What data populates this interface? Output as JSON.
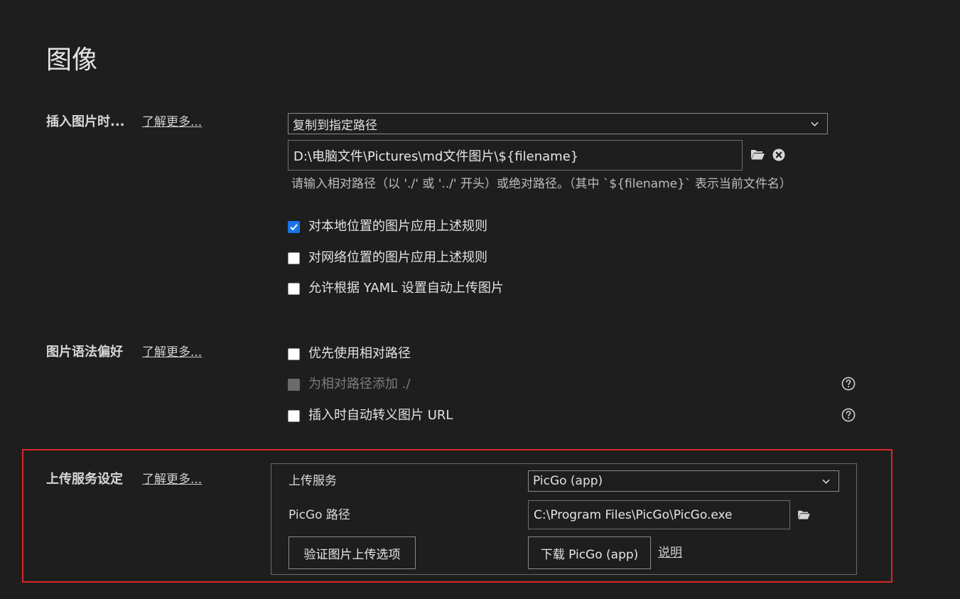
{
  "page": {
    "title": "图像"
  },
  "learn_more": "了解更多...",
  "insert": {
    "label": "插入图片时...",
    "action_select": "复制到指定路径",
    "path_value": "D:\\电脑文件\\Pictures\\md文件图片\\${filename}",
    "hint": "请输入相对路径（以 './' 或 '../' 开头）或绝对路径。（其中 `${filename}` 表示当前文件名）",
    "checkboxes": [
      {
        "label": "对本地位置的图片应用上述规则",
        "checked": true
      },
      {
        "label": "对网络位置的图片应用上述规则",
        "checked": false
      },
      {
        "label": "允许根据 YAML 设置自动上传图片",
        "checked": false
      }
    ]
  },
  "syntax": {
    "label": "图片语法偏好",
    "checkboxes": [
      {
        "label": "优先使用相对路径",
        "checked": false,
        "disabled": false
      },
      {
        "label": "为相对路径添加 ./",
        "checked": false,
        "disabled": true
      },
      {
        "label": "插入时自动转义图片 URL",
        "checked": false,
        "disabled": false
      }
    ]
  },
  "upload": {
    "label": "上传服务设定",
    "service_label": "上传服务",
    "service_value": "PicGo (app)",
    "path_label": "PicGo 路径",
    "path_value": "C:\\Program Files\\PicGo\\PicGo.exe",
    "verify_button": "验证图片上传选项",
    "download_button": "下载 PicGo (app)",
    "explain_link": "说明"
  },
  "colors": {
    "accent": "#1a73e8",
    "highlight_frame": "#d9262a",
    "background": "#1e1e1e"
  },
  "icons": [
    "folder-icon",
    "clear-icon",
    "help-icon",
    "chevron-down-icon"
  ]
}
